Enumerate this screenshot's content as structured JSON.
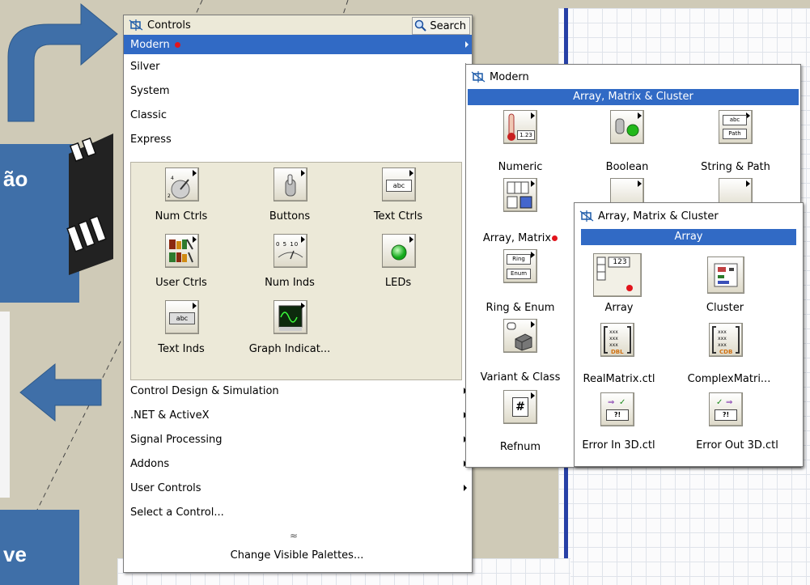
{
  "left_callouts": {
    "top_text": "ão",
    "bottom_text": "ve"
  },
  "controls_palette": {
    "title": "Controls",
    "search_label": "Search",
    "categories": [
      {
        "label": "Modern",
        "selected": true,
        "has_submenu": true
      },
      {
        "label": "Silver",
        "has_submenu": true
      },
      {
        "label": "System",
        "has_submenu": true
      },
      {
        "label": "Classic",
        "has_submenu": true
      },
      {
        "label": "Express",
        "has_submenu": true
      }
    ],
    "express_items": [
      {
        "label": "Num Ctrls",
        "icon": "num-ctrls-icon"
      },
      {
        "label": "Buttons",
        "icon": "buttons-icon"
      },
      {
        "label": "Text Ctrls",
        "icon": "text-ctrls-icon"
      },
      {
        "label": "User Ctrls",
        "icon": "user-ctrls-icon"
      },
      {
        "label": "Num Inds",
        "icon": "num-inds-icon"
      },
      {
        "label": "LEDs",
        "icon": "leds-icon"
      },
      {
        "label": "Text Inds",
        "icon": "text-inds-icon"
      },
      {
        "label": "Graph Indicat...",
        "icon": "graph-indicators-icon"
      }
    ],
    "more_categories": [
      {
        "label": "Control Design & Simulation",
        "has_submenu": true
      },
      {
        "label": ".NET & ActiveX",
        "has_submenu": true
      },
      {
        "label": "Signal Processing",
        "has_submenu": true
      },
      {
        "label": "Addons",
        "has_submenu": true
      },
      {
        "label": "User Controls",
        "has_submenu": true
      },
      {
        "label": "Select a Control...",
        "has_submenu": false
      }
    ],
    "footer_label": "Change Visible Palettes..."
  },
  "modern_palette": {
    "title": "Modern",
    "header": "Array, Matrix & Cluster",
    "items": [
      {
        "label": "Numeric",
        "icon": "numeric-icon"
      },
      {
        "label": "Boolean",
        "icon": "boolean-icon"
      },
      {
        "label": "String & Path",
        "icon": "string-path-icon"
      },
      {
        "label": "Array, Matrix",
        "icon": "array-matrix-icon"
      },
      {
        "label": "Ring & Enum",
        "icon": "ring-enum-icon"
      },
      {
        "label": "Variant & Class",
        "icon": "variant-class-icon"
      },
      {
        "label": "Refnum",
        "icon": "refnum-icon"
      }
    ],
    "icon_texts": {
      "numeric": "1.23",
      "string_top": "abc",
      "string_bottom": "Path",
      "ring": "Ring",
      "enum": "Enum",
      "refnum": "#"
    }
  },
  "array_palette": {
    "title": "Array, Matrix & Cluster",
    "header": "Array",
    "items": [
      {
        "label": "Array",
        "icon": "array-icon"
      },
      {
        "label": "Cluster",
        "icon": "cluster-icon"
      },
      {
        "label": "RealMatrix.ctl",
        "icon": "real-matrix-icon"
      },
      {
        "label": "ComplexMatri...",
        "icon": "complex-matrix-icon"
      },
      {
        "label": "Error In 3D.ctl",
        "icon": "error-in-icon"
      },
      {
        "label": "Error Out 3D.ctl",
        "icon": "error-out-icon"
      }
    ],
    "icon_texts": {
      "array_value": "123",
      "real_tag": "DBL",
      "complex_tag": "CDB",
      "error_mark": "?!"
    }
  },
  "express_icon_texts": {
    "text_ctrl": "abc",
    "text_ind": "abc",
    "num_ind_scale": "0  5  10"
  },
  "colors": {
    "selection": "#316ac5",
    "callout": "#3f6fa8",
    "red_dot": "#e2141c"
  }
}
